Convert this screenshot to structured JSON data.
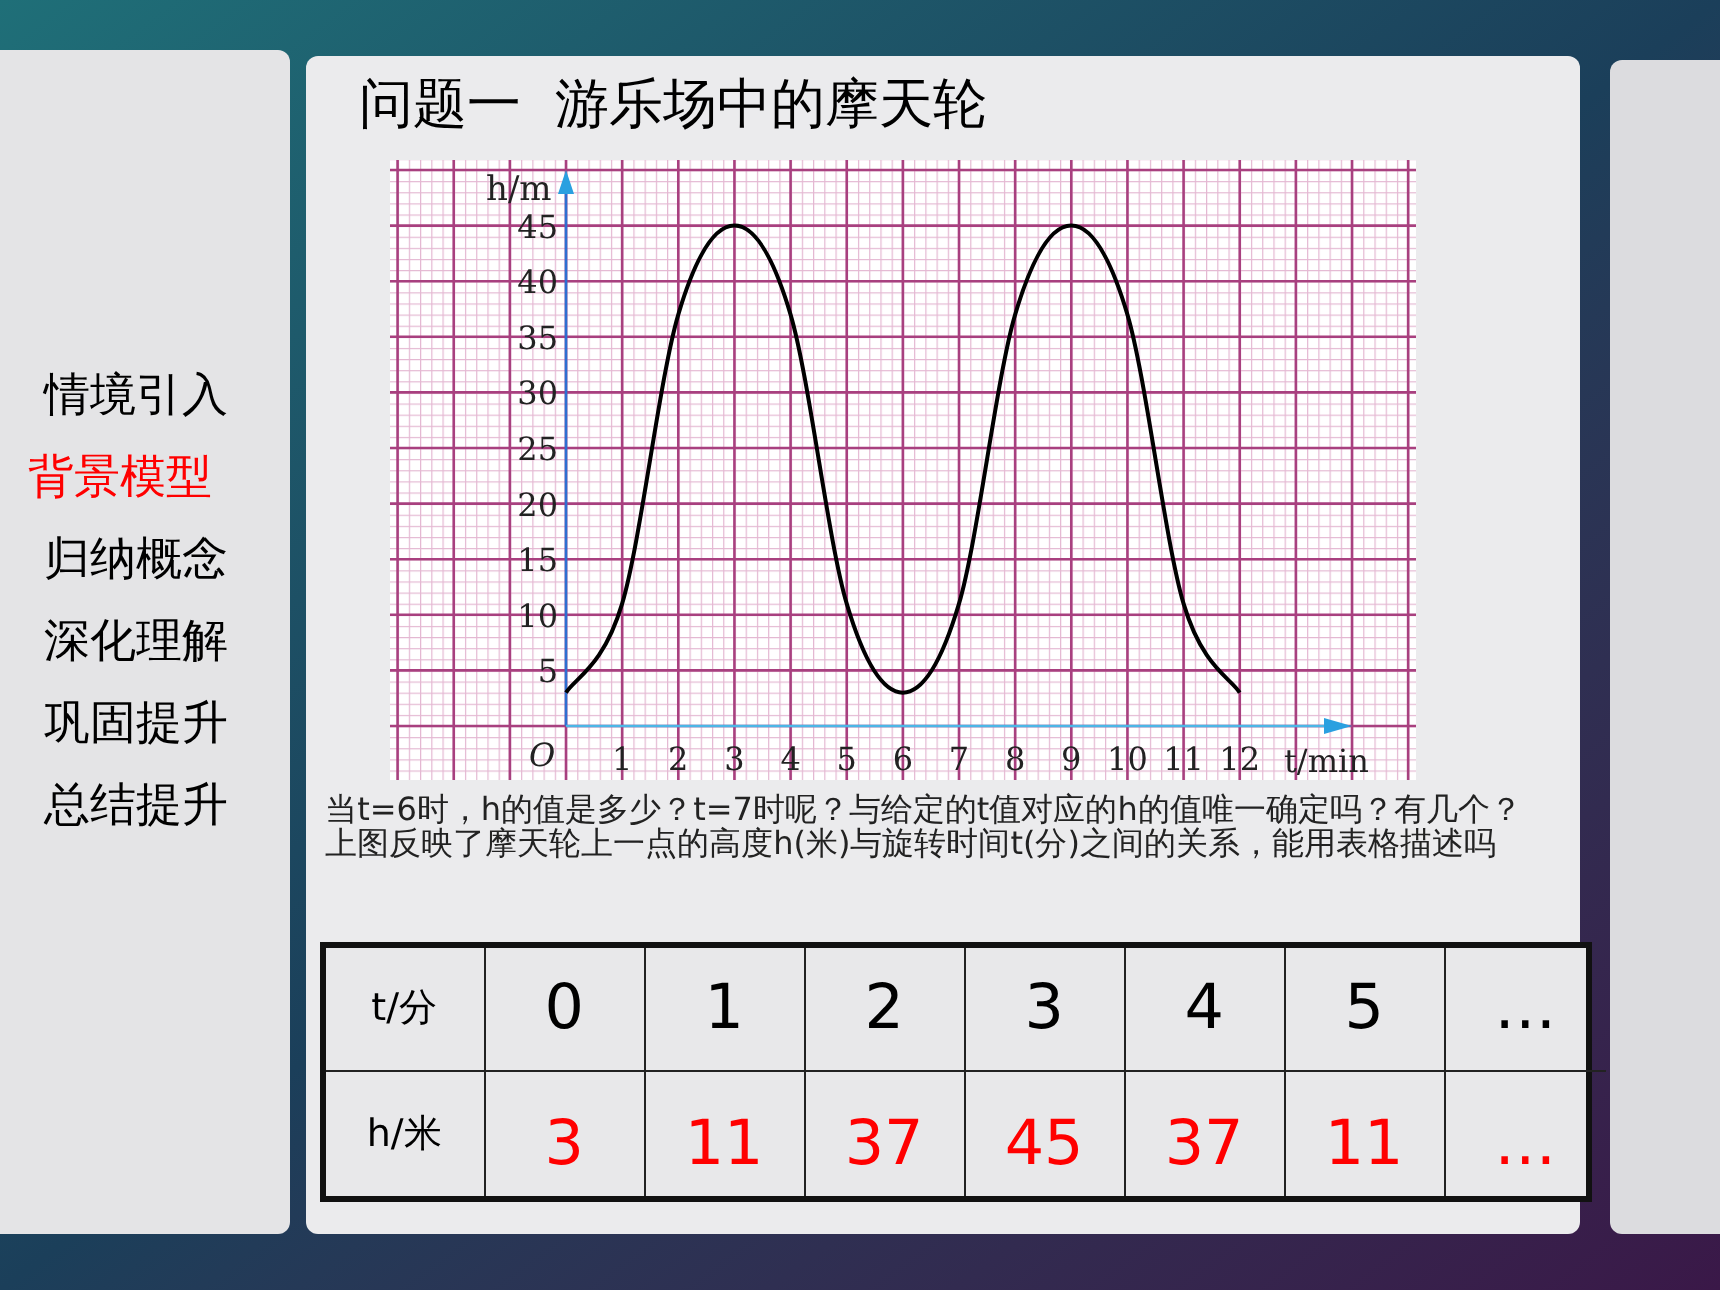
{
  "menu": {
    "items": [
      {
        "label": "情境引入",
        "selected": false
      },
      {
        "label": "背景模型",
        "selected": true
      },
      {
        "label": "归纳概念",
        "selected": false
      },
      {
        "label": "深化理解",
        "selected": false
      },
      {
        "label": "巩固提升",
        "selected": false
      },
      {
        "label": "总结提升",
        "selected": false
      }
    ]
  },
  "slide": {
    "title": "问题一  游乐场中的摩天轮",
    "chart_data": {
      "type": "line",
      "xlabel": "t/min",
      "ylabel": "h/m",
      "annotations": [
        "O"
      ],
      "grid": true,
      "x": [
        0,
        1,
        2,
        3,
        4,
        5,
        6,
        7,
        8,
        9,
        10,
        11,
        12
      ],
      "series": [
        {
          "color": "#000000",
          "values": [
            3,
            11,
            37,
            45,
            37,
            11,
            3,
            11,
            37,
            45,
            37,
            11,
            3
          ]
        }
      ],
      "xlim": [
        0,
        14
      ],
      "ylim": [
        0,
        50
      ],
      "xticks": [
        1,
        2,
        3,
        4,
        5,
        6,
        7,
        8,
        9,
        10,
        11,
        12
      ],
      "yticks": [
        5,
        10,
        15,
        20,
        25,
        30,
        35,
        40,
        45
      ]
    },
    "questions": [
      "当t=6时，h的值是多少？t=7时呢？与给定的t值对应的h的值唯一确定吗？有几个？",
      "上图反映了摩天轮上一点的高度h(米)与旋转时间t(分)之间的关系，能用表格描述吗"
    ],
    "table": {
      "rows": [
        {
          "header": "t/分",
          "cells": [
            "0",
            "1",
            "2",
            "3",
            "4",
            "5",
            "…"
          ]
        },
        {
          "header": "h/米",
          "cells": [
            "3",
            "11",
            "37",
            "45",
            "37",
            "11",
            "…"
          ]
        }
      ]
    }
  }
}
